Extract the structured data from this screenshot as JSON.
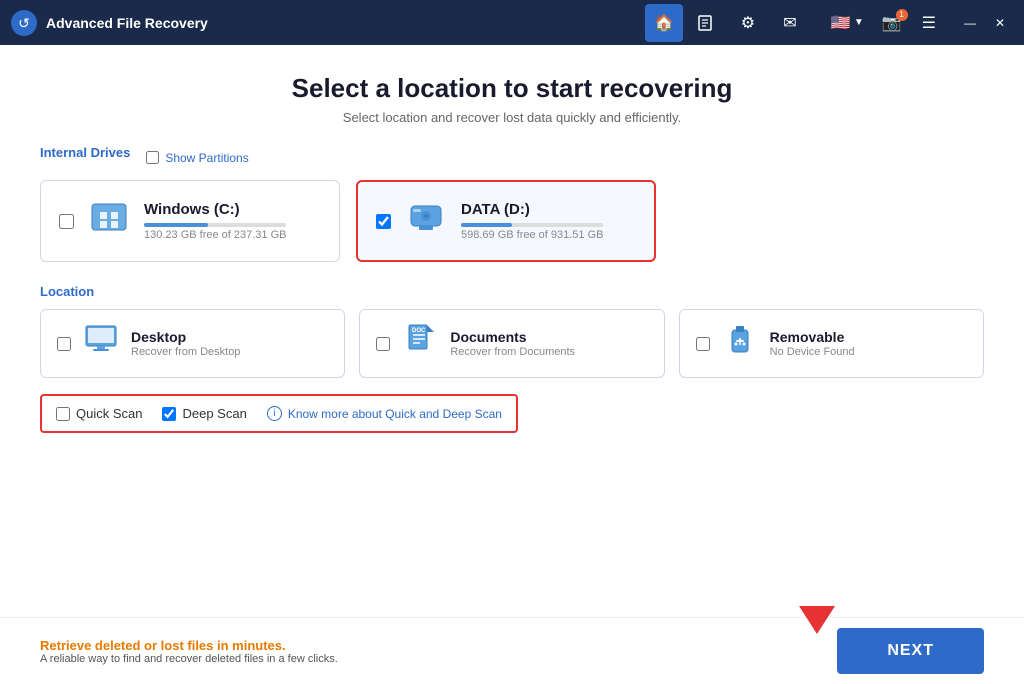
{
  "app": {
    "title": "Advanced File Recovery",
    "logo_text": "🔵"
  },
  "titlebar": {
    "nav_items": [
      {
        "id": "home",
        "label": "🏠",
        "active": true
      },
      {
        "id": "search",
        "label": "🔍",
        "active": false
      },
      {
        "id": "settings",
        "label": "⚙",
        "active": false
      },
      {
        "id": "mail",
        "label": "✉",
        "active": false
      }
    ],
    "flag": "🇺🇸",
    "camera_badge": "1",
    "menu": "☰",
    "minimize": "—",
    "close": "✕"
  },
  "header": {
    "title": "Select a location to start recovering",
    "subtitle": "Select location and recover lost data quickly and efficiently."
  },
  "internal_drives": {
    "section_label": "Internal Drives",
    "show_partitions_label": "Show Partitions",
    "drives": [
      {
        "name": "Windows (C:)",
        "space": "130.23 GB free of 237.31 GB",
        "checked": false,
        "selected": false,
        "bar_pct": 45
      },
      {
        "name": "DATA (D:)",
        "space": "598.69 GB free of 931.51 GB",
        "checked": true,
        "selected": true,
        "bar_pct": 36
      }
    ]
  },
  "location": {
    "section_label": "Location",
    "items": [
      {
        "name": "Desktop",
        "sub": "Recover from Desktop",
        "icon_type": "monitor",
        "checked": false
      },
      {
        "name": "Documents",
        "sub": "Recover from Documents",
        "icon_type": "doc",
        "checked": false
      },
      {
        "name": "Removable",
        "sub": "No Device Found",
        "icon_type": "usb",
        "checked": false
      }
    ]
  },
  "scan": {
    "quick_scan_label": "Quick Scan",
    "deep_scan_label": "Deep Scan",
    "quick_checked": false,
    "deep_checked": true,
    "info_label": "Know more about Quick and Deep Scan"
  },
  "footer": {
    "headline": "Retrieve deleted or lost files in minutes.",
    "subtext": "A reliable way to find and recover deleted files in a few clicks."
  },
  "next_button": {
    "label": "NEXT"
  }
}
